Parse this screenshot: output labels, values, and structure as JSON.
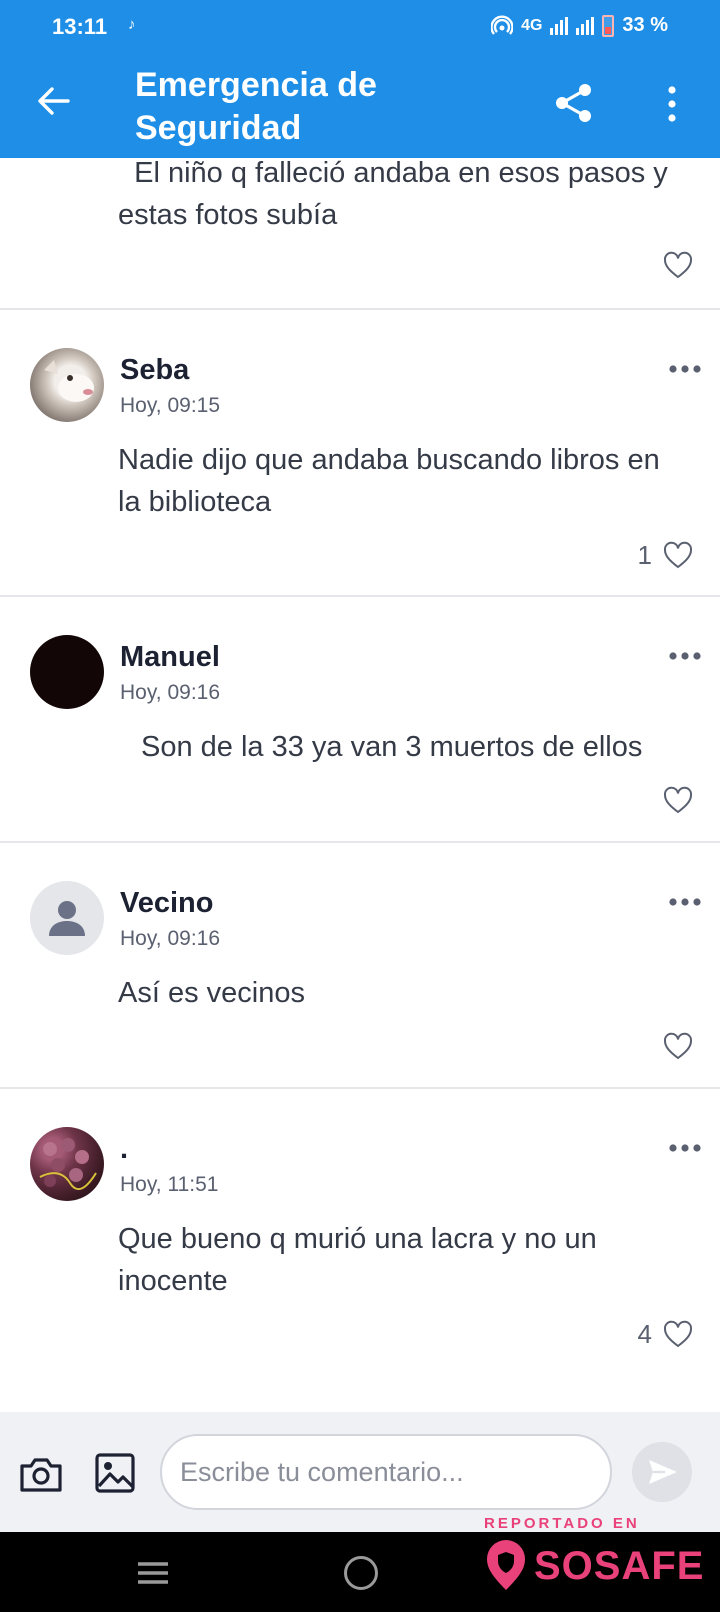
{
  "status_bar": {
    "time": "13:11",
    "network": "4G",
    "battery": "33 %"
  },
  "header": {
    "title": "Emergencia de Seguridad"
  },
  "comments": [
    {
      "author": "",
      "time": "",
      "text": "  El niño q falleció andaba en esos pasos y estas fotos subía",
      "likes": ""
    },
    {
      "author": "Seba",
      "time": "Hoy, 09:15",
      "text": "Nadie dijo que andaba buscando libros en la biblioteca",
      "likes": "1"
    },
    {
      "author": "Manuel",
      "time": "Hoy, 09:16",
      "text": "Son de la 33 ya van 3 muertos de ellos",
      "likes": ""
    },
    {
      "author": "Vecino",
      "time": "Hoy, 09:16",
      "text": "Así es vecinos",
      "likes": ""
    },
    {
      "author": ".",
      "time": "Hoy, 11:51",
      "text": "Que bueno q murió una lacra y no un inocente",
      "likes": "4"
    }
  ],
  "composer": {
    "placeholder": "Escribe tu comentario..."
  },
  "watermark": {
    "reported": "REPORTADO EN",
    "brand": "SOSAFE"
  },
  "colors": {
    "primary": "#1e8ee6",
    "brand": "#e9417a"
  },
  "icons": [
    "back-arrow-icon",
    "share-icon",
    "more-vertical-icon",
    "more-horizontal-icon",
    "heart-icon",
    "camera-icon",
    "image-icon",
    "send-icon",
    "menu-icon",
    "home-icon"
  ]
}
